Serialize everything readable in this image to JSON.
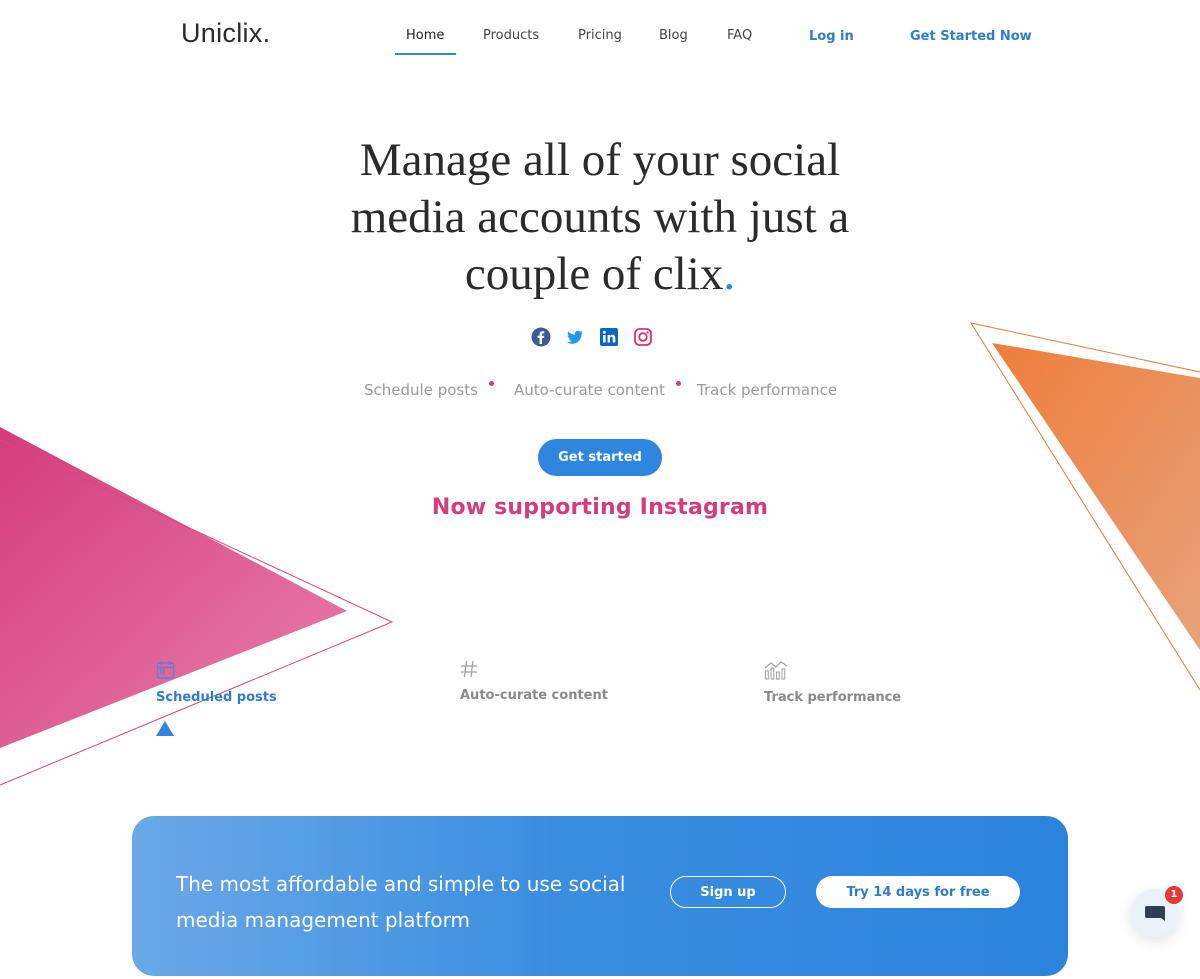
{
  "header": {
    "brand": "Uniclix.",
    "nav": [
      "Home",
      "Products",
      "Pricing",
      "Blog",
      "FAQ"
    ],
    "active_nav": "Home",
    "login": "Log in",
    "cta": "Get Started Now"
  },
  "hero": {
    "title_lines": [
      "Manage all of your social",
      "media accounts with just a",
      "couple of clix"
    ],
    "title_period": ".",
    "social_icons": [
      "facebook-icon",
      "twitter-icon",
      "linkedin-icon",
      "instagram-icon"
    ],
    "features": [
      "Schedule posts",
      "Auto-curate content",
      "Track performance"
    ],
    "button": "Get started",
    "announcement": "Now supporting Instagram"
  },
  "feature_tabs": [
    {
      "label": "Scheduled posts",
      "icon": "calendar-icon",
      "active": true
    },
    {
      "label": "Auto-curate content",
      "icon": "hashtag-icon",
      "active": false
    },
    {
      "label": "Track performance",
      "icon": "chart-icon",
      "active": false
    }
  ],
  "banner": {
    "text": "The most affordable and simple to use social media management platform",
    "signup": "Sign up",
    "trial": "Try 14 days for free"
  },
  "chat": {
    "badge_count": "1"
  },
  "colors": {
    "accent": "#2e86de",
    "pink": "#d63b7e",
    "orange": "#ec7c3c"
  }
}
